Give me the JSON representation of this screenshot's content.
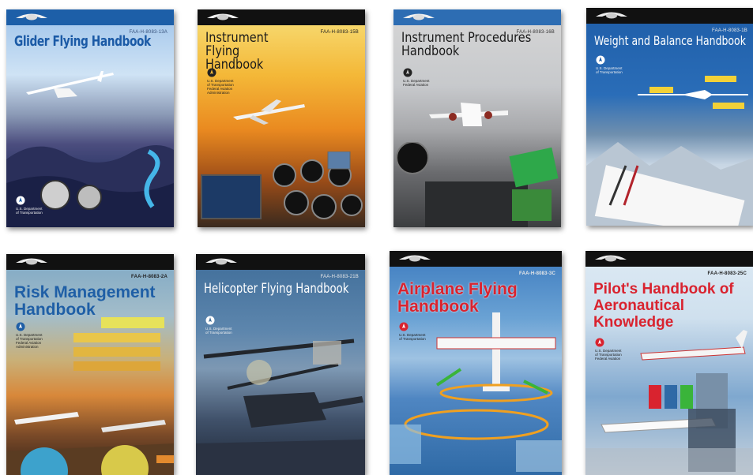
{
  "books": [
    {
      "title": "Glider Flying Handbook",
      "code": "FAA-H-8083-13A"
    },
    {
      "title": "Instrument Flying Handbook",
      "code": "FAA-H-8083-15B"
    },
    {
      "title": "Instrument Procedures Handbook",
      "code": "FAA-H-8083-16B"
    },
    {
      "title": "Weight and Balance Handbook",
      "code": "FAA-H-8083-1B"
    },
    {
      "title": "Risk Management Handbook",
      "code": "FAA-H-8083-2A"
    },
    {
      "title": "Helicopter Flying Handbook",
      "code": "FAA-H-8083-21B"
    },
    {
      "title": "Airplane Flying Handbook",
      "code": "FAA-H-8083-3C"
    },
    {
      "title": "Pilot's Handbook of Aeronautical Knowledge",
      "code": "FAA-H-8083-25C"
    }
  ],
  "publisher": {
    "line1": "U.S. Department",
    "line2": "of Transportation",
    "line3": "Federal Aviation",
    "line4": "Administration"
  },
  "colors": {
    "topbar_dark": "#1a1a1a",
    "topbar_blue": "#2d6db3",
    "title_red": "#d9232f",
    "title_blue_text": "#1f5fa6"
  },
  "icons": [
    "asa-logo-icon",
    "dot-seal-icon"
  ]
}
